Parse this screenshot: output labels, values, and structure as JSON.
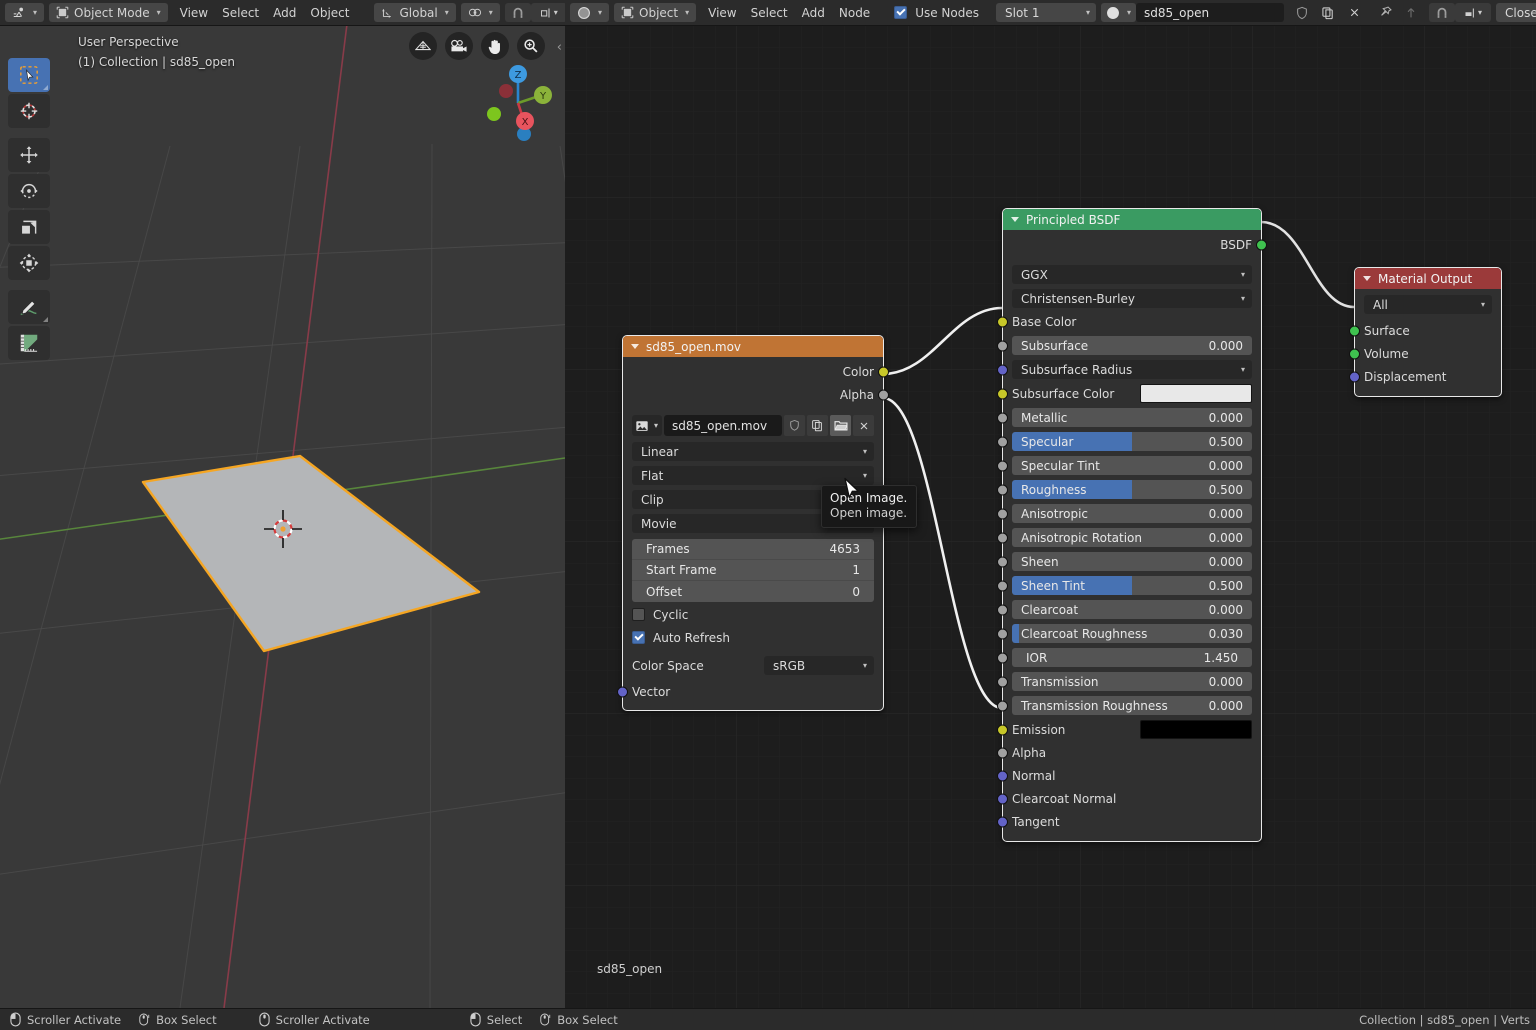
{
  "viewport_header": {
    "editor_type_icon": "editor-type-icon",
    "mode": "Object Mode",
    "menus": [
      "View",
      "Select",
      "Add",
      "Object"
    ],
    "transform_orientation": "Global",
    "snap_icon": "magnet-icon",
    "proportional_icon": "proportional-editing-icon",
    "shading_icons": [
      "solid-shading-icon",
      "falloff-curve-icon"
    ]
  },
  "viewport": {
    "perspective_label": "User Perspective",
    "collection_label": "(1) Collection | sd85_open",
    "gizmo_icons": [
      "toggle-grid-icon",
      "camera-view-icon",
      "move-view-icon",
      "zoom-view-icon"
    ],
    "axis_labels": {
      "z": "Z",
      "y": "Y",
      "x": "X"
    },
    "toolbar_items": [
      {
        "name": "tool-tweak",
        "icon": "cursor-arrow-icon",
        "active": true
      },
      {
        "name": "tool-cursor",
        "icon": "3d-cursor-icon",
        "active": false
      },
      {
        "name": "tool-move",
        "icon": "move-icon",
        "active": false
      },
      {
        "name": "tool-rotate",
        "icon": "rotate-icon",
        "active": false
      },
      {
        "name": "tool-scale",
        "icon": "scale-icon",
        "active": false
      },
      {
        "name": "tool-transform",
        "icon": "transform-icon",
        "active": false
      },
      {
        "name": "tool-annotate",
        "icon": "annotate-pencil-icon",
        "active": false
      },
      {
        "name": "tool-measure",
        "icon": "measure-ruler-icon",
        "active": false
      }
    ]
  },
  "node_header": {
    "editor_type_icon": "shader-editor-icon",
    "shader_type": "Object",
    "menus": [
      "View",
      "Select",
      "Add",
      "Node"
    ],
    "use_nodes_label": "Use Nodes",
    "use_nodes_checked": true,
    "slot": "Slot 1",
    "material_icon": "material-sphere-icon",
    "material_name": "sd85_open",
    "fake_user_icon": "shield-icon",
    "new_material_icon": "duplicate-icon",
    "unlink_icon": "close-x-icon",
    "pin_icon": "pin-icon",
    "parent_icon": "up-arrow-icon",
    "snap_icon": "magnet-icon",
    "snap_element_icon": "snap-element-icon",
    "snap_target": "Closest"
  },
  "node_editor": {
    "breadcrumb": "sd85_open",
    "tooltip": {
      "title": "Open Image.",
      "body": "Open image."
    },
    "cursor_icon": "mouse-pointer-icon"
  },
  "image_node": {
    "title": "sd85_open.mov",
    "outputs": [
      {
        "label": "Color",
        "socket": "yellow"
      },
      {
        "label": "Alpha",
        "socket": "gray"
      }
    ],
    "datablock_icon": "image-datablock-icon",
    "filename": "sd85_open.mov",
    "buttons": [
      {
        "name": "fake-user-button",
        "icon": "shield-icon"
      },
      {
        "name": "new-image-button",
        "icon": "duplicate-icon"
      },
      {
        "name": "open-image-button",
        "icon": "folder-open-icon"
      },
      {
        "name": "unlink-button",
        "icon": "close-x-icon"
      }
    ],
    "interpolation": "Linear",
    "projection": "Flat",
    "extension": "Clip",
    "source": "Movie",
    "frames_label": "Frames",
    "frames_value": "4653",
    "start_frame_label": "Start Frame",
    "start_frame_value": "1",
    "offset_label": "Offset",
    "offset_value": "0",
    "cyclic_label": "Cyclic",
    "cyclic_checked": false,
    "auto_refresh_label": "Auto Refresh",
    "auto_refresh_checked": true,
    "color_space_label": "Color Space",
    "color_space_value": "sRGB",
    "vector_input": "Vector"
  },
  "bsdf_node": {
    "title": "Principled BSDF",
    "output_label": "BSDF",
    "distribution": "GGX",
    "subsurface_method": "Christensen-Burley",
    "base_color_label": "Base Color",
    "subsurface_radius_label": "Subsurface Radius",
    "subsurface_color_label": "Subsurface Color",
    "subsurface_color_value": "#e8e8e8",
    "emission_label": "Emission",
    "emission_color_value": "#000000",
    "sliders": [
      {
        "label": "Subsurface",
        "value": "0.000",
        "fill": 0
      },
      {
        "label": "Metallic",
        "value": "0.000",
        "fill": 0
      },
      {
        "label": "Specular",
        "value": "0.500",
        "fill": 50
      },
      {
        "label": "Specular Tint",
        "value": "0.000",
        "fill": 0
      },
      {
        "label": "Roughness",
        "value": "0.500",
        "fill": 50
      },
      {
        "label": "Anisotropic",
        "value": "0.000",
        "fill": 0
      },
      {
        "label": "Anisotropic Rotation",
        "value": "0.000",
        "fill": 0
      },
      {
        "label": "Sheen",
        "value": "0.000",
        "fill": 0
      },
      {
        "label": "Sheen Tint",
        "value": "0.500",
        "fill": 50
      },
      {
        "label": "Clearcoat",
        "value": "0.000",
        "fill": 0
      },
      {
        "label": "Clearcoat Roughness",
        "value": "0.030",
        "fill": 3
      },
      {
        "label": "IOR",
        "value": "1.450",
        "fill": 0
      },
      {
        "label": "Transmission",
        "value": "0.000",
        "fill": 0
      },
      {
        "label": "Transmission Roughness",
        "value": "0.000",
        "fill": 0
      }
    ],
    "plain_inputs": [
      {
        "label": "Alpha",
        "socket": "gray"
      },
      {
        "label": "Normal",
        "socket": "purple"
      },
      {
        "label": "Clearcoat Normal",
        "socket": "purple"
      },
      {
        "label": "Tangent",
        "socket": "purple"
      }
    ]
  },
  "output_node": {
    "title": "Material Output",
    "target": "All",
    "inputs": [
      {
        "label": "Surface",
        "socket": "green"
      },
      {
        "label": "Volume",
        "socket": "green"
      },
      {
        "label": "Displacement",
        "socket": "purple"
      }
    ]
  },
  "status_bar": {
    "items": [
      {
        "icon": "mouse-left-icon",
        "label": "Scroller Activate"
      },
      {
        "icon": "mouse-middle-icon",
        "label": "Box Select"
      },
      {
        "icon": "mouse-right-icon",
        "label": "Scroller Activate"
      },
      {
        "icon": "mouse-left-icon",
        "label": "Select"
      },
      {
        "icon": "mouse-middle-icon",
        "label": "Box Select"
      }
    ],
    "right_text": "Collection | sd85_open | Verts"
  },
  "colors": {
    "image_node_header": "#c07434",
    "bsdf_node_header": "#3a9b62",
    "output_node_header": "#9b3a3a",
    "accent_blue": "#4772b3",
    "select_orange": "#f5a623"
  }
}
